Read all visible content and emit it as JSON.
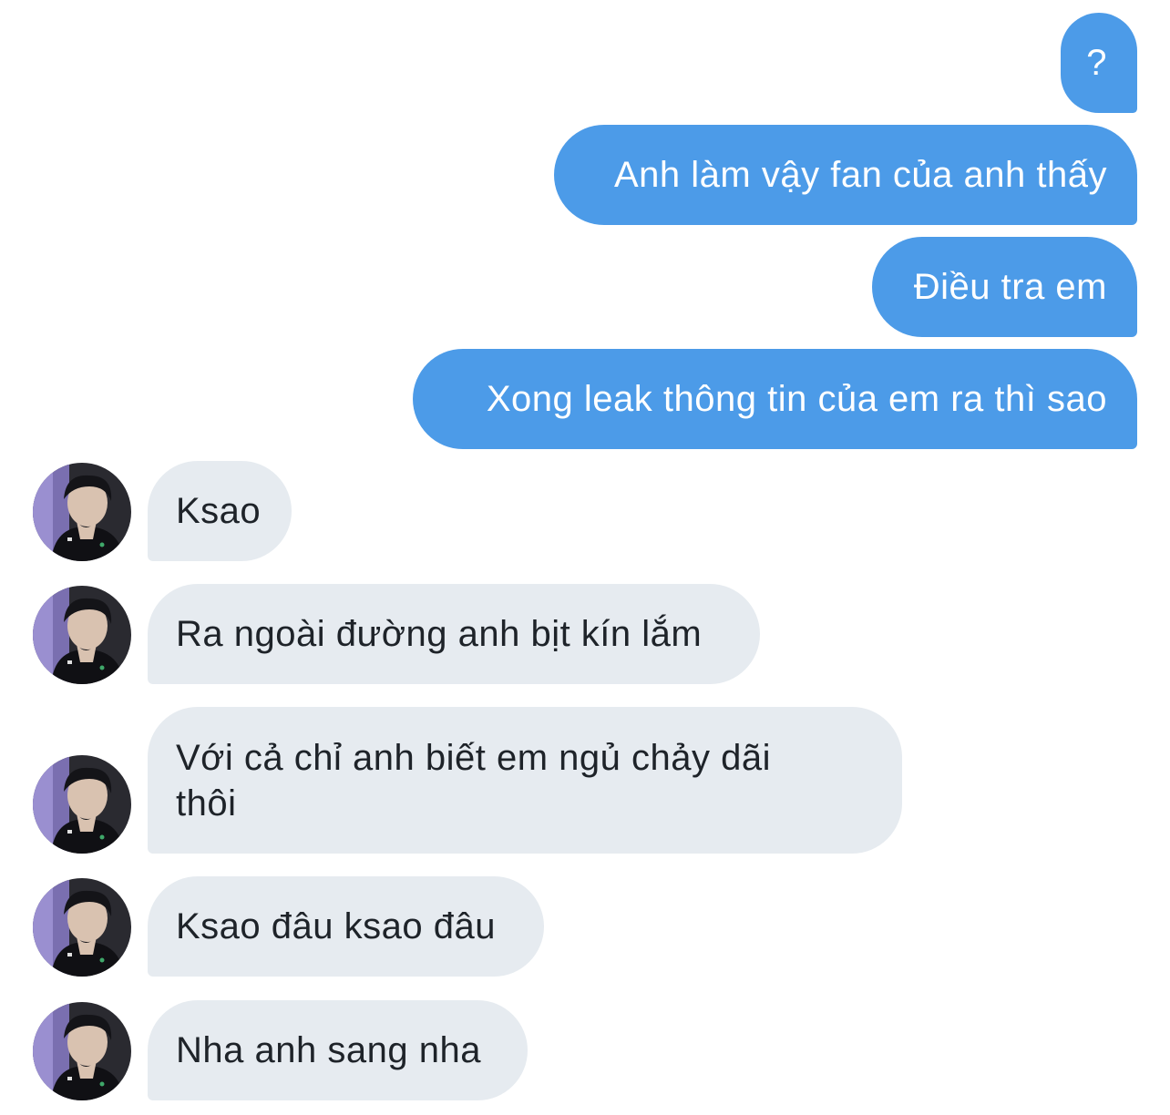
{
  "conversation": {
    "sent_messages": [
      {
        "text": "?"
      },
      {
        "text": "Anh làm vậy fan của anh thấy"
      },
      {
        "text": "Điều tra em"
      },
      {
        "text": "Xong leak thông tin của em ra thì sao"
      }
    ],
    "received_messages": [
      {
        "text": "Ksao"
      },
      {
        "text": "Ra ngoài đường anh bịt kín lắm"
      },
      {
        "line1": "Với cả chỉ anh biết em ngủ chảy dãi",
        "line2": "thôi"
      },
      {
        "text": "Ksao đâu ksao đâu"
      },
      {
        "text": "Nha anh sang nha"
      }
    ]
  },
  "colors": {
    "sent_bubble": "#4c9be8",
    "received_bubble": "#e6ebf0",
    "received_text": "#1e2329",
    "background": "#ffffff"
  }
}
